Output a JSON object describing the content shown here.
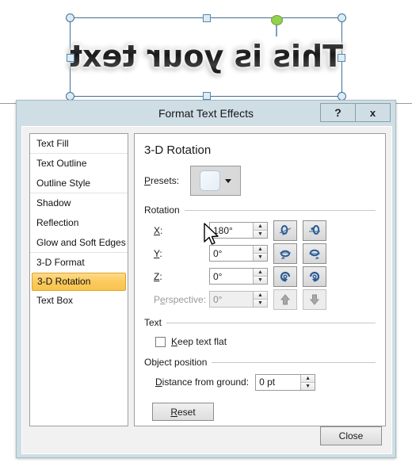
{
  "canvas": {
    "artistic_text": "This is your text",
    "mirrored": true,
    "rotation_handle_color": "#92d050",
    "selection_border_color": "#3f6f93"
  },
  "dialog": {
    "title": "Format Text Effects",
    "titlebar_buttons": [
      {
        "name": "help-button",
        "label": "?"
      },
      {
        "name": "close-x-button",
        "label": "x"
      }
    ],
    "sidebar": {
      "items": [
        {
          "label": "Text Fill",
          "selected": false
        },
        {
          "label": "Text Outline",
          "selected": false
        },
        {
          "label": "Outline Style",
          "selected": false
        },
        {
          "label": "Shadow",
          "selected": false
        },
        {
          "label": "Reflection",
          "selected": false
        },
        {
          "label": "Glow and Soft Edges",
          "selected": false
        },
        {
          "label": "3-D Format",
          "selected": false
        },
        {
          "label": "3-D Rotation",
          "selected": true
        },
        {
          "label": "Text Box",
          "selected": false
        }
      ],
      "selected_color": "#f9c44f"
    },
    "content": {
      "heading": "3-D Rotation",
      "presets_label": "Presets:",
      "rotation_group": "Rotation",
      "rows": [
        {
          "label": "X:",
          "value": "180°",
          "disabled": false
        },
        {
          "label": "Y:",
          "value": "0°",
          "disabled": false
        },
        {
          "label": "Z:",
          "value": "0°",
          "disabled": false
        },
        {
          "label": "Perspective:",
          "value": "0°",
          "disabled": true
        }
      ],
      "text_group": "Text",
      "keep_text_flat_label": "Keep text flat",
      "keep_text_flat_checked": false,
      "object_position_group": "Object position",
      "distance_label": "Distance from ground:",
      "distance_value": "0 pt",
      "reset_label": "Reset"
    },
    "footer": {
      "close_label": "Close"
    }
  }
}
